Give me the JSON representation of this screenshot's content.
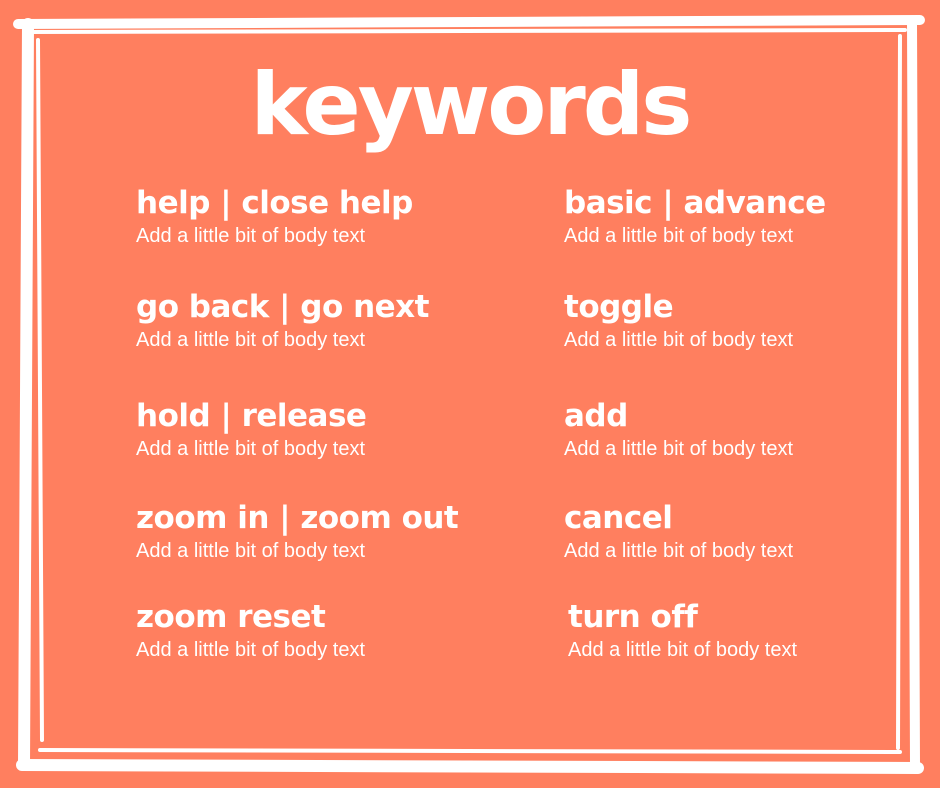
{
  "title": "keywords",
  "colors": {
    "background": "#FF7F5F",
    "frame": "#FFFFFF",
    "text": "#FFFFFF"
  },
  "left_items": [
    {
      "keyword": "help | close help",
      "body": "Add a little bit of body text"
    },
    {
      "keyword": "go back | go next",
      "body": "Add a little bit of body text"
    },
    {
      "keyword": "hold | release",
      "body": "Add a little bit of body text"
    },
    {
      "keyword": "zoom in | zoom out",
      "body": "Add a little bit of body text"
    },
    {
      "keyword": "zoom reset",
      "body": "Add a little bit of body text"
    }
  ],
  "right_items": [
    {
      "keyword": "basic | advance",
      "body": "Add a little bit of body text"
    },
    {
      "keyword": "toggle",
      "body": "Add a little bit of body text"
    },
    {
      "keyword": "add",
      "body": "Add a little bit of body text"
    },
    {
      "keyword": "cancel",
      "body": "Add a little bit of body text"
    },
    {
      "keyword": "turn off",
      "body": "Add a little bit of body text"
    }
  ]
}
